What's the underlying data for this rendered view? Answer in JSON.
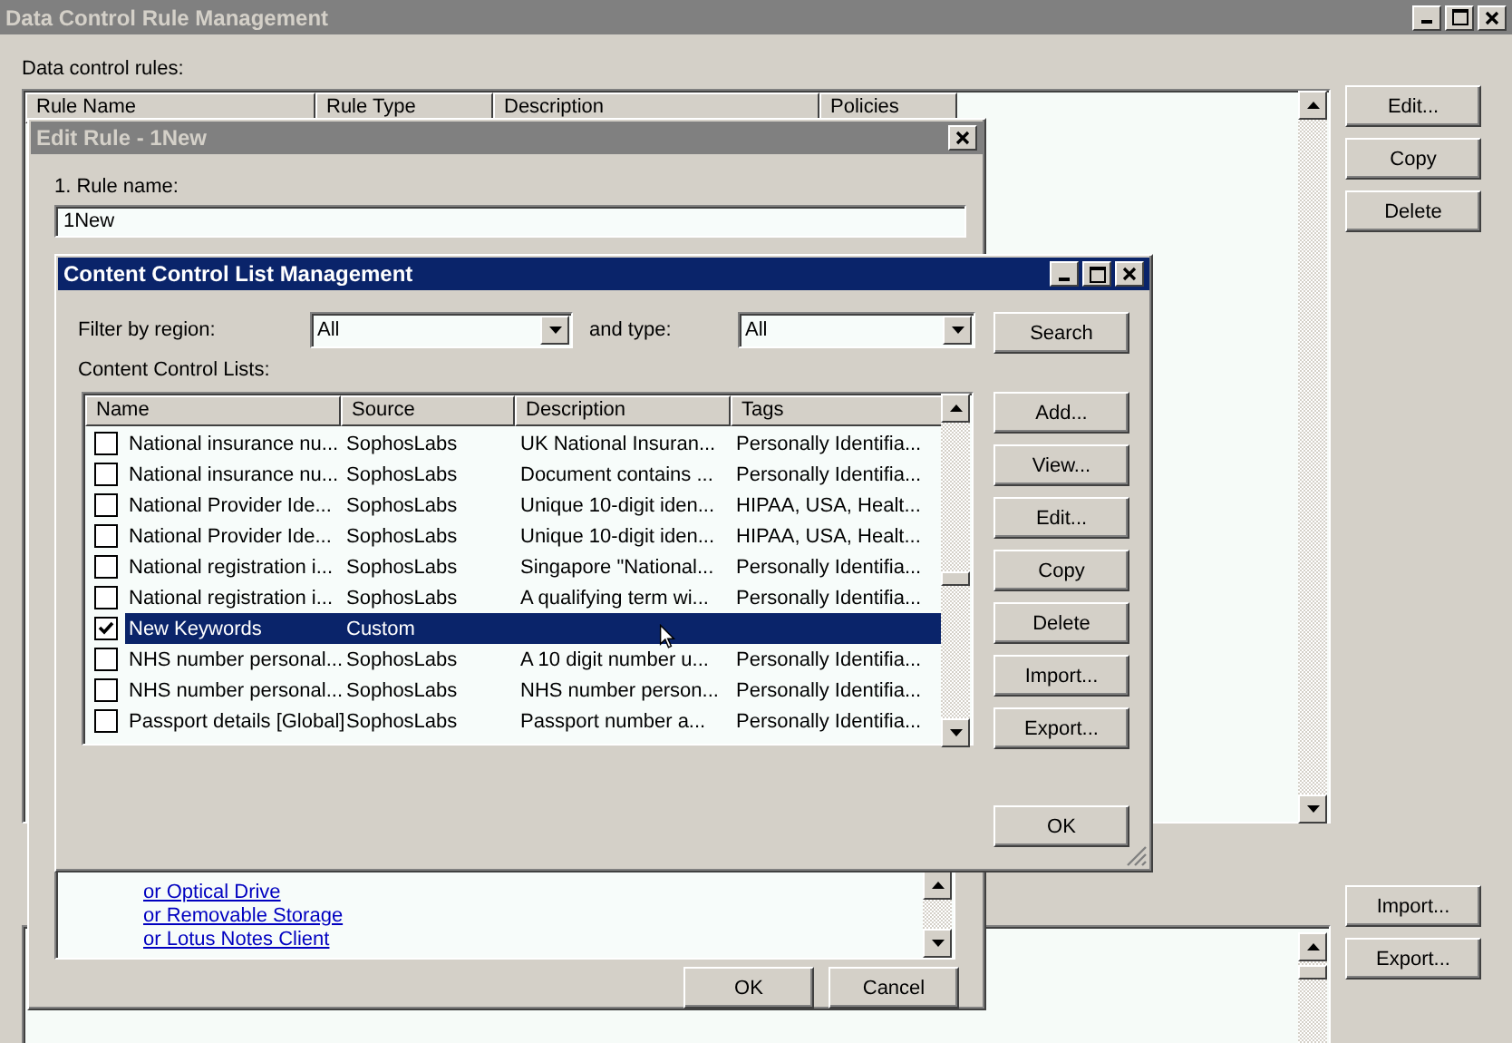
{
  "main_window": {
    "title": "Data Control Rule Management",
    "rules_label": "Data control rules:",
    "columns": [
      "Rule Name",
      "Rule Type",
      "Description",
      "Policies"
    ],
    "buttons": [
      "Edit...",
      "Copy",
      "Delete"
    ],
    "lower_buttons": [
      "Import...",
      "Export..."
    ]
  },
  "edit_rule": {
    "title": "Edit Rule - 1New",
    "rule_name_label": "1. Rule name:",
    "rule_name_value": "1New",
    "links": [
      "or Optical Drive",
      "or Removable Storage",
      "or Lotus Notes Client"
    ],
    "buttons": [
      "OK",
      "Cancel"
    ]
  },
  "ccl_dialog": {
    "title": "Content Control List Management",
    "region_label": "Filter by region:",
    "region_value": "All",
    "type_label": "and type:",
    "type_value": "All",
    "search_button": "Search",
    "lists_label": "Content Control Lists:",
    "columns": [
      "Name",
      "Source",
      "Description",
      "Tags"
    ],
    "rows": [
      {
        "name": "National insurance nu...",
        "source": "SophosLabs",
        "description": "UK National Insuran...",
        "tags": "Personally Identifia...",
        "checked": false,
        "selected": false
      },
      {
        "name": "National insurance nu...",
        "source": "SophosLabs",
        "description": "Document contains ...",
        "tags": "Personally Identifia...",
        "checked": false,
        "selected": false
      },
      {
        "name": "National Provider Ide...",
        "source": "SophosLabs",
        "description": "Unique 10-digit iden...",
        "tags": "HIPAA, USA, Healt...",
        "checked": false,
        "selected": false
      },
      {
        "name": "National Provider Ide...",
        "source": "SophosLabs",
        "description": "Unique 10-digit iden...",
        "tags": "HIPAA, USA, Healt...",
        "checked": false,
        "selected": false
      },
      {
        "name": "National registration i...",
        "source": "SophosLabs",
        "description": "Singapore \"National...",
        "tags": "Personally Identifia...",
        "checked": false,
        "selected": false
      },
      {
        "name": "National registration i...",
        "source": "SophosLabs",
        "description": "A qualifying term wi...",
        "tags": "Personally Identifia...",
        "checked": false,
        "selected": false
      },
      {
        "name": "New Keywords",
        "source": "Custom",
        "description": "",
        "tags": "",
        "checked": true,
        "selected": true
      },
      {
        "name": "NHS number personal...",
        "source": "SophosLabs",
        "description": "A 10 digit number u...",
        "tags": "Personally Identifia...",
        "checked": false,
        "selected": false
      },
      {
        "name": "NHS number personal...",
        "source": "SophosLabs",
        "description": "NHS number person...",
        "tags": "Personally Identifia...",
        "checked": false,
        "selected": false
      },
      {
        "name": "Passport details [Global]",
        "source": "SophosLabs",
        "description": "Passport number a...",
        "tags": "Personally Identifia...",
        "checked": false,
        "selected": false
      }
    ],
    "buttons": [
      "Add...",
      "View...",
      "Edit...",
      "Copy",
      "Delete",
      "Import...",
      "Export..."
    ],
    "ok_button": "OK"
  }
}
